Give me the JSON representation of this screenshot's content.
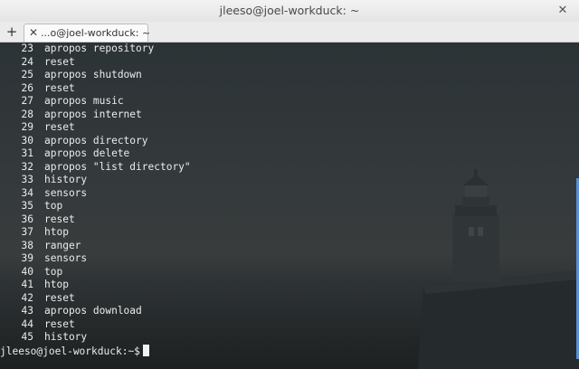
{
  "window": {
    "title": "jleeso@joel-workduck: ~",
    "close_glyph": "✕"
  },
  "tabs": [
    {
      "label": "...o@joel-workduck: ~",
      "close_glyph": "✕"
    }
  ],
  "new_tab_glyph": "+",
  "history": [
    {
      "num": "23",
      "cmd": "apropos repository"
    },
    {
      "num": "24",
      "cmd": "reset"
    },
    {
      "num": "25",
      "cmd": "apropos shutdown"
    },
    {
      "num": "26",
      "cmd": "reset"
    },
    {
      "num": "27",
      "cmd": "apropos music"
    },
    {
      "num": "28",
      "cmd": "apropos internet"
    },
    {
      "num": "29",
      "cmd": "reset"
    },
    {
      "num": "30",
      "cmd": "apropos directory"
    },
    {
      "num": "31",
      "cmd": "apropos delete"
    },
    {
      "num": "32",
      "cmd": "apropos \"list directory\""
    },
    {
      "num": "33",
      "cmd": "history"
    },
    {
      "num": "34",
      "cmd": "sensors"
    },
    {
      "num": "35",
      "cmd": "top"
    },
    {
      "num": "36",
      "cmd": "reset"
    },
    {
      "num": "37",
      "cmd": "htop"
    },
    {
      "num": "38",
      "cmd": "ranger"
    },
    {
      "num": "39",
      "cmd": "sensors"
    },
    {
      "num": "40",
      "cmd": "top"
    },
    {
      "num": "41",
      "cmd": "htop"
    },
    {
      "num": "42",
      "cmd": "reset"
    },
    {
      "num": "43",
      "cmd": "apropos download"
    },
    {
      "num": "44",
      "cmd": "reset"
    },
    {
      "num": "45",
      "cmd": "history"
    }
  ],
  "prompt": "jleeso@joel-workduck:~$",
  "colors": {
    "scrollbar_accent": "#5b8fd6",
    "terminal_text": "#ececec"
  },
  "icons": {
    "tab_close": "close-icon",
    "new_tab": "plus-icon",
    "window_close": "close-icon"
  }
}
